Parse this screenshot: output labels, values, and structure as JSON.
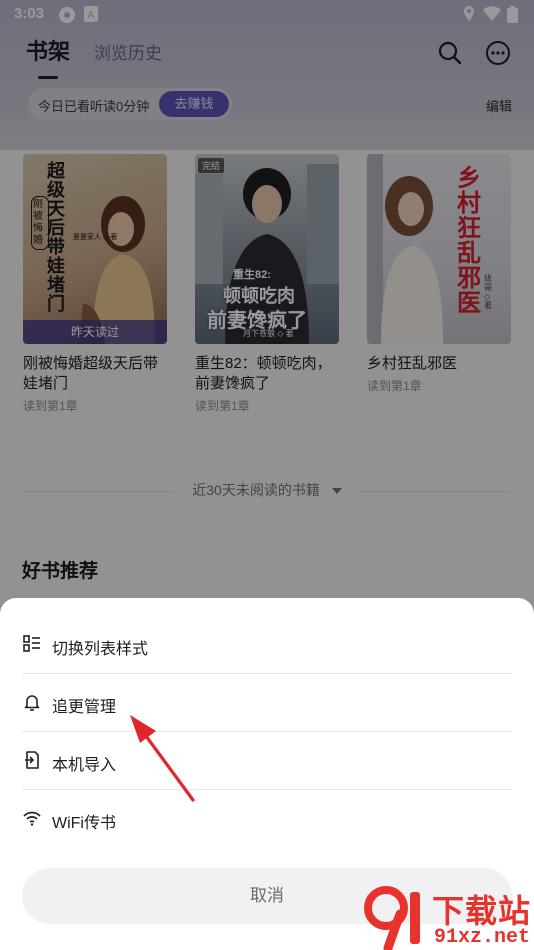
{
  "status_bar": {
    "time": "3:03"
  },
  "header": {
    "tab_active": "书架",
    "tab_inactive": "浏览历史",
    "reading_text": "今日已看听读0分钟",
    "earn_button": "去赚钱",
    "edit_label": "编辑"
  },
  "books": [
    {
      "title": "刚被悔婚超级天后带娃堵门",
      "progress": "读到第1章",
      "cover_text": "超级天后带娃堵门",
      "cover_sub": "刚被悔婚",
      "cover_badge": "昨天读过",
      "cover_author": "夏夏家人 ◇ 著"
    },
    {
      "title": "重生82：顿顿吃肉，前妻馋疯了",
      "progress": "读到第1章",
      "cover_tag": "完结",
      "cover_line1": "重生82:",
      "cover_line2": "顿顿吃肉",
      "cover_line3": "前妻馋疯了",
      "cover_author": "月下苍狼 ◇ 著"
    },
    {
      "title": "乡村狂乱邪医",
      "progress": "读到第1章",
      "cover_text": "乡村狂乱邪医",
      "cover_author": "珑哥 ◇ 著"
    }
  ],
  "inactive_books_label": "近30天未阅读的书籍",
  "recommend_title": "好书推荐",
  "sheet": {
    "items": [
      {
        "label": "切换列表样式",
        "icon": "list-style-icon"
      },
      {
        "label": "追更管理",
        "icon": "bell-icon"
      },
      {
        "label": "本机导入",
        "icon": "import-icon"
      },
      {
        "label": "WiFi传书",
        "icon": "wifi-icon"
      }
    ],
    "cancel_label": "取消"
  },
  "watermark": {
    "text": "下载站",
    "url_text": "91xz.net"
  },
  "colors": {
    "accent": "#5956b8",
    "arrow": "#e0262b",
    "watermark": "#e8322e"
  }
}
